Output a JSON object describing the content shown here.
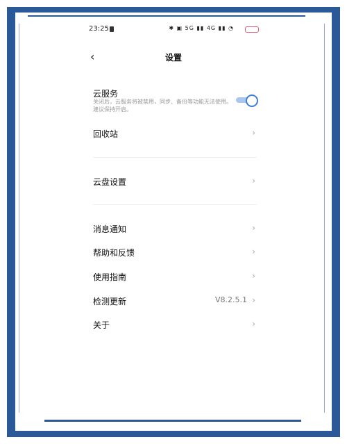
{
  "status": {
    "time": "23:25",
    "icons": "✱ ▣ 5G ▮▮ 4G ▮▮ ◔"
  },
  "header": {
    "title": "设置"
  },
  "cloud": {
    "label": "云服务",
    "description": "关闭后，云服务将被禁用，同步、备份等功能无法使用。建议保持开启。",
    "enabled": true
  },
  "items": [
    {
      "label": "回收站"
    },
    {
      "label": "云盘设置"
    },
    {
      "label": "消息通知"
    },
    {
      "label": "帮助和反馈"
    },
    {
      "label": "使用指南"
    },
    {
      "label": "检测更新",
      "value": "V8.2.5.1"
    },
    {
      "label": "关于"
    }
  ],
  "colors": {
    "frame": "#2b5896",
    "accent": "#3b7ed9"
  }
}
